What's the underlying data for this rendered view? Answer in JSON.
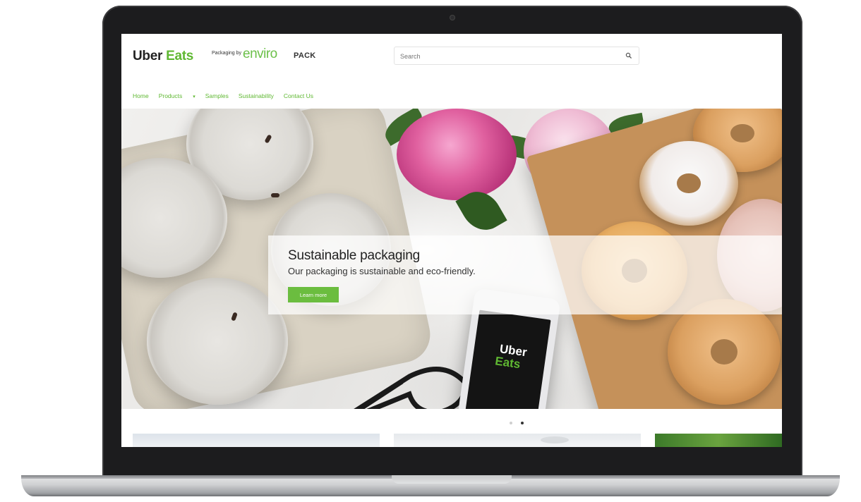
{
  "brand": {
    "uber": "Uber",
    "eats": "Eats",
    "packaging_by": "Packaging by",
    "enviro": "enviro",
    "pack": "PACK"
  },
  "search": {
    "placeholder": "Search",
    "icon": "search-icon"
  },
  "nav": {
    "items": [
      "Home",
      "Products",
      "Samples",
      "Sustainability",
      "Contact Us"
    ],
    "products_suffix": "▾"
  },
  "hero": {
    "title": "Sustainable packaging",
    "subtitle": "Our packaging is sustainable and eco-friendly.",
    "button_label": "Learn more",
    "phone_line1": "Uber",
    "phone_line2": "Eats"
  },
  "carousel": {
    "slide_count": 2,
    "active_index": 1
  },
  "colors": {
    "accent_green": "#5fb832",
    "button_green": "#6bbd3f"
  }
}
